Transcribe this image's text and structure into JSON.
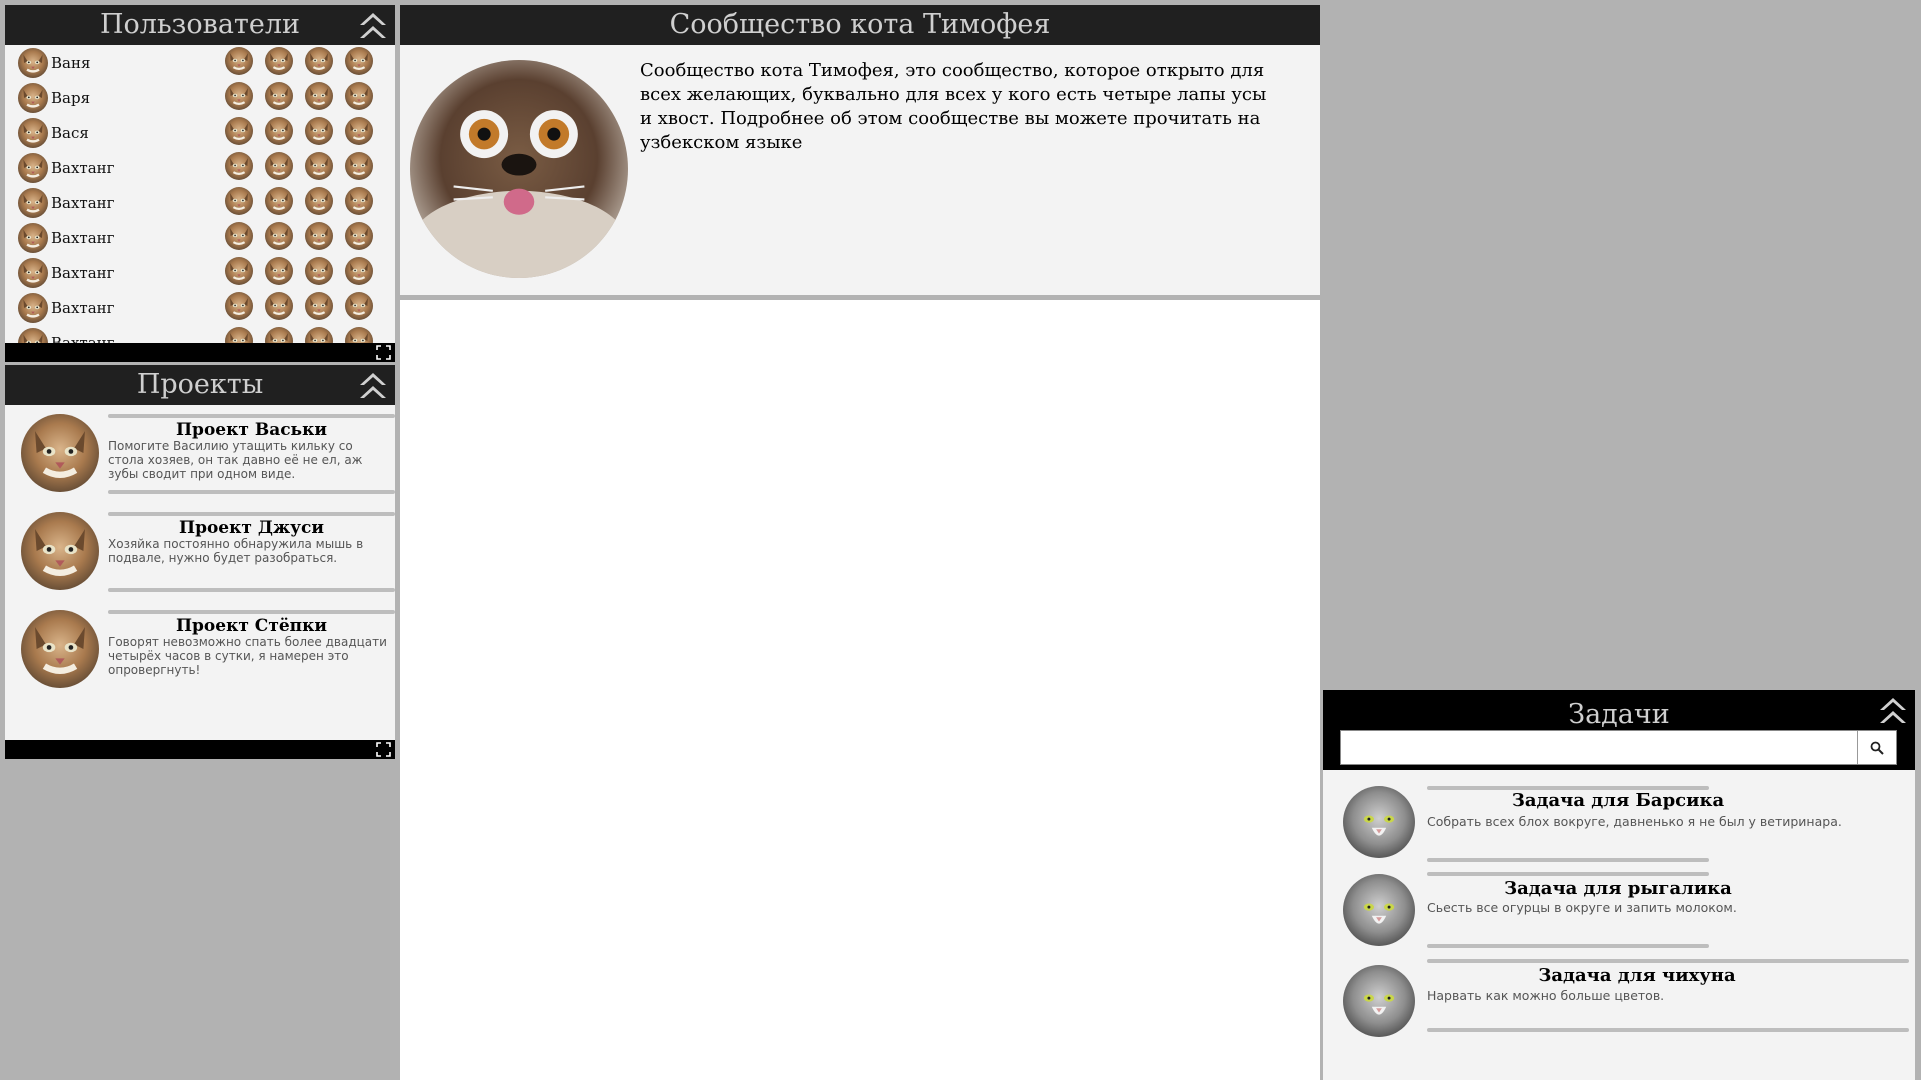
{
  "users_panel": {
    "title": "Пользователи",
    "users": [
      "Ваня",
      "Варя",
      "Вася",
      "Вахтанг",
      "Вахтанг",
      "Вахтанг",
      "Вахтанг",
      "Вахтанг",
      "Вахтанг"
    ]
  },
  "projects_panel": {
    "title": "Проекты",
    "projects": [
      {
        "title": "Проект Васьки",
        "desc": "Помогите Василию утащить кильку со стола хозяев, он так давно её не ел, аж зубы сводит при одном виде."
      },
      {
        "title": "Проект Джуси",
        "desc": "Хозяйка постоянно обнаружила мышь в подвале, нужно будет разобраться."
      },
      {
        "title": "Проект Стёпки",
        "desc": "Говорят невозможно спать более двадцати четырёх часов в сутки, я намерен это опровергнуть!"
      }
    ]
  },
  "community": {
    "title": "Сообщество кота Тимофея",
    "description": "Сообщество кота Тимофея, это сообщество, которое открыто для всех желающих, буквально для всех у кого есть четыре лапы усы и хвост. Подробнее об этом сообществе вы можете прочитать на узбекском языке"
  },
  "tasks_panel": {
    "title": "Задачи",
    "search_value": "",
    "tasks": [
      {
        "title": "Задача для Барсика",
        "desc": "Собрать всех блох вокруге, давненько я не был у ветиринара."
      },
      {
        "title": "Задача для рыгалика",
        "desc": "Сьесть все огурцы в округе и запить молоком."
      },
      {
        "title": "Задача для чихуна",
        "desc": "Нарвать как можно больше цветов."
      }
    ]
  },
  "colors": {
    "background": "#b2b2b2",
    "header": "#202020",
    "panel": "#f3f3f3",
    "footer": "#000000",
    "divider": "#bdbdbd"
  },
  "icons": {
    "collapse": "double-chevron-up-icon",
    "expand": "fullscreen-icon",
    "search": "magnifier-icon",
    "avatar": "cat-avatar"
  }
}
